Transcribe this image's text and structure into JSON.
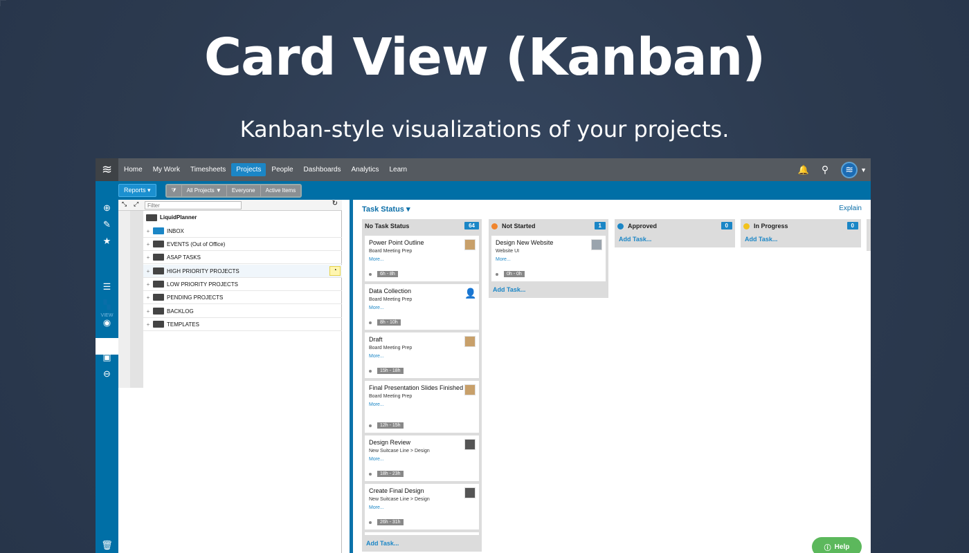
{
  "hero": {
    "title": "Card View (Kanban)",
    "subtitle": "Kanban-style visualizations of your projects."
  },
  "nav": {
    "items": [
      "Home",
      "My Work",
      "Timesheets",
      "Projects",
      "People",
      "Dashboards",
      "Analytics",
      "Learn"
    ],
    "active": "Projects"
  },
  "subbar": {
    "reports": "Reports ▾",
    "filters": [
      "All Projects ▼",
      "Everyone",
      "Active Items"
    ]
  },
  "rail": {
    "view_label": "VIEW"
  },
  "tree": {
    "filter_placeholder": "Filter",
    "root": "LiquidPlanner",
    "rows": [
      "INBOX",
      "EVENTS (Out of Office)",
      "ASAP TASKS",
      "HIGH PRIORITY PROJECTS",
      "LOW PRIORITY PROJECTS",
      "PENDING PROJECTS",
      "BACKLOG",
      "TEMPLATES"
    ]
  },
  "board": {
    "title": "Task Status ▾",
    "explain": "Explain",
    "add_task": "Add Task...",
    "columns": [
      {
        "name": "No Task Status",
        "count": "64",
        "color": "",
        "cards": [
          {
            "title": "Power Point Outline",
            "sub": "Board Meeting Prep",
            "more": "More...",
            "hours": "6h - 8h"
          },
          {
            "title": "Data Collection",
            "sub": "Board Meeting Prep",
            "more": "More...",
            "hours": "8h - 10h"
          },
          {
            "title": "Draft",
            "sub": "Board Meeting Prep",
            "more": "More...",
            "hours": "15h - 18h"
          },
          {
            "title": "Final Presentation Slides Finished",
            "sub": "Board Meeting Prep",
            "more": "More...",
            "hours": "12h - 15h"
          },
          {
            "title": "Design Review",
            "sub": "New Suitcase Line  >  Design",
            "more": "More...",
            "hours": "18h - 23h"
          },
          {
            "title": "Create Final Design",
            "sub": "New Suitcase Line  >  Design",
            "more": "More...",
            "hours": "26h - 31h"
          }
        ]
      },
      {
        "name": "Not Started",
        "count": "1",
        "color": "#f0852d",
        "cards": [
          {
            "title": "Design New Website",
            "sub": "Website UI",
            "more": "More...",
            "hours": "0h - 0h"
          }
        ]
      },
      {
        "name": "Approved",
        "count": "0",
        "color": "#1b86c6",
        "cards": []
      },
      {
        "name": "In Progress",
        "count": "0",
        "color": "#f2c21b",
        "cards": []
      }
    ]
  },
  "help": "Help"
}
